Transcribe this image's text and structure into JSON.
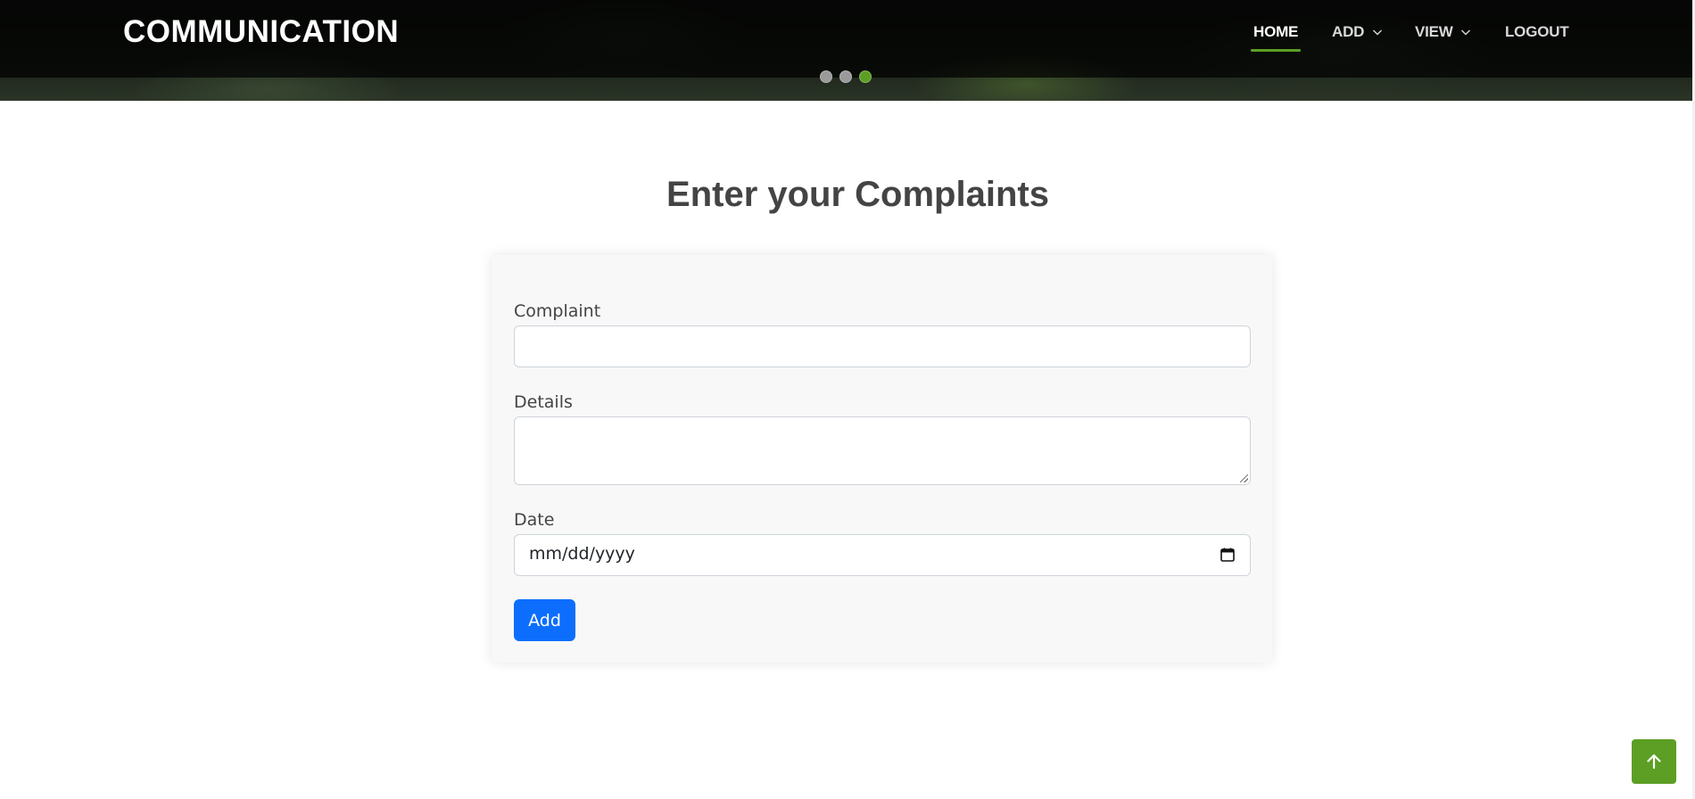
{
  "header": {
    "logo": "COMMUNICATION",
    "nav": [
      {
        "label": "HOME",
        "active": true,
        "dropdown": false
      },
      {
        "label": "ADD",
        "active": false,
        "dropdown": true
      },
      {
        "label": "VIEW",
        "active": false,
        "dropdown": true
      },
      {
        "label": "LOGOUT",
        "active": false,
        "dropdown": false
      }
    ],
    "slider_dots": {
      "count": 3,
      "active_index": 2
    }
  },
  "main": {
    "title": "Enter your Complaints",
    "form": {
      "complaint_label": "Complaint",
      "complaint_value": "",
      "details_label": "Details",
      "details_value": "",
      "date_label": "Date",
      "date_placeholder": "mm/dd/yyyy",
      "submit_label": "Add"
    }
  },
  "icons": {
    "calendar": "calendar-icon",
    "back_to_top": "arrow-up-icon",
    "dropdown": "chevron-down-icon"
  },
  "colors": {
    "accent": "#5c9f24",
    "primary_button": "#0d6efd",
    "text": "#444444"
  }
}
